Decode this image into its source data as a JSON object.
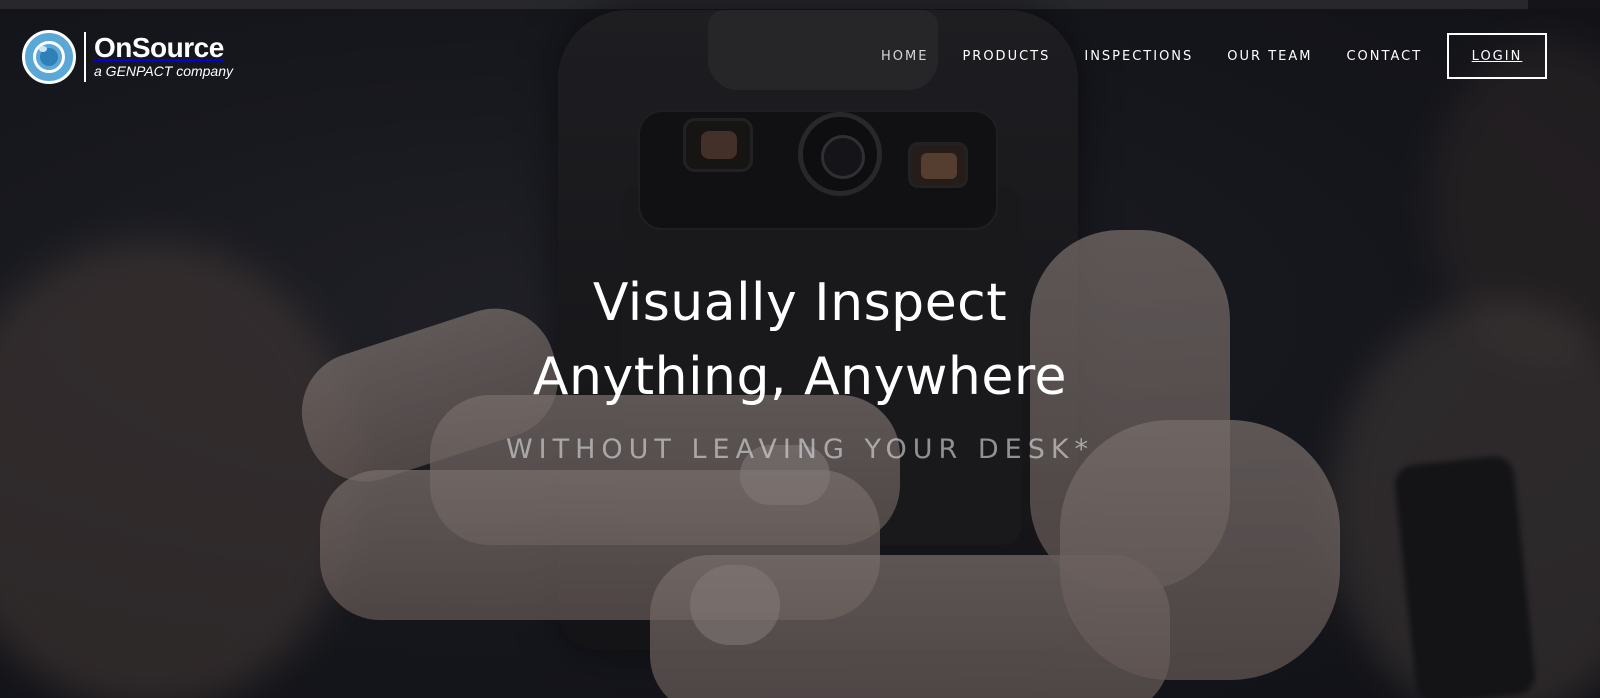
{
  "brand": {
    "name": "OnSource",
    "tagline": "a GENPACT company",
    "logo_icon": "camera-lens-icon",
    "accent_color": "#5ba8d8"
  },
  "nav": {
    "items": [
      {
        "label": "HOME",
        "active": true
      },
      {
        "label": "PRODUCTS",
        "active": false
      },
      {
        "label": "INSPECTIONS",
        "active": false
      },
      {
        "label": "OUR TEAM",
        "active": false
      },
      {
        "label": "CONTACT",
        "active": false
      }
    ],
    "login_label": "LOGIN"
  },
  "hero": {
    "headline_line1": "Visually Inspect",
    "headline_line2": "Anything, Anywhere",
    "subhead": "WITHOUT LEAVING YOUR DESK*",
    "background_image": "hands-holding-rugged-phone"
  }
}
